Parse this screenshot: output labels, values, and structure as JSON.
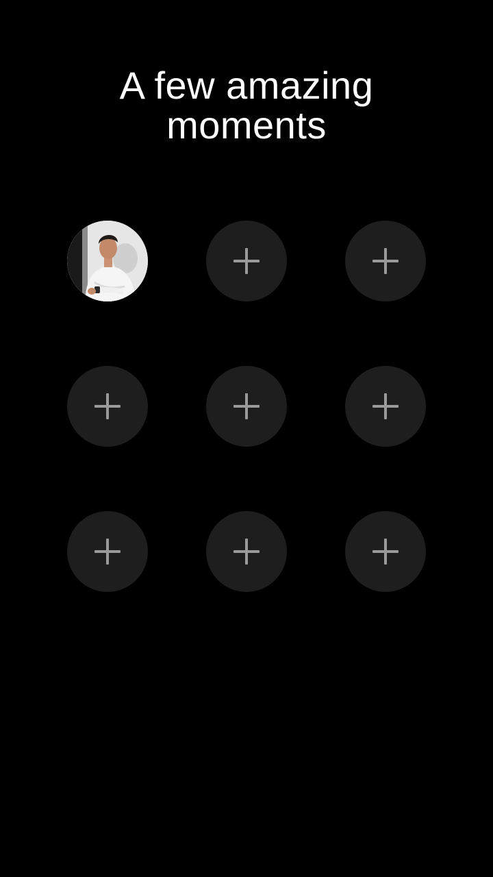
{
  "header": {
    "title_line1": "A few amazing",
    "title_line2": "moments"
  },
  "grid": {
    "rows": 3,
    "columns": 3,
    "filled_slots": 1,
    "empty_slot_icon": "plus-icon",
    "slot_color": "#1e1e1e",
    "plus_color": "#9a9a9a"
  },
  "colors": {
    "background": "#000000",
    "title": "#ffffff"
  }
}
